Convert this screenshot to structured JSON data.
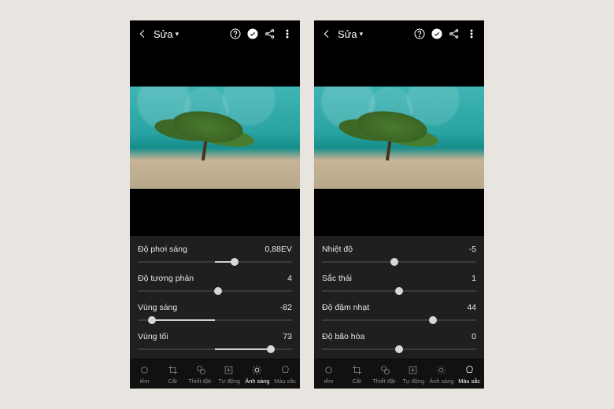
{
  "screens": [
    {
      "title": "Sửa",
      "sliders": [
        {
          "label": "Độ phơi sáng",
          "value": "0,88EV",
          "knob_pct": 63,
          "fill_from_pct": 50,
          "fill_to_pct": 63,
          "gradient": null
        },
        {
          "label": "Độ tương phản",
          "value": "4",
          "knob_pct": 52,
          "fill_from_pct": 50,
          "fill_to_pct": 52,
          "gradient": null
        },
        {
          "label": "Vùng sáng",
          "value": "-82",
          "knob_pct": 9,
          "fill_from_pct": 9,
          "fill_to_pct": 50,
          "gradient": null
        },
        {
          "label": "Vùng tối",
          "value": "73",
          "knob_pct": 86,
          "fill_from_pct": 50,
          "fill_to_pct": 86,
          "gradient": null
        }
      ],
      "tabs": [
        {
          "label": "iểm",
          "icon": "aim"
        },
        {
          "label": "Cắt",
          "icon": "crop"
        },
        {
          "label": "Thiết đặt sẵn",
          "icon": "preset"
        },
        {
          "label": "Tự động",
          "icon": "auto"
        },
        {
          "label": "Ánh sáng",
          "icon": "light",
          "active": true
        },
        {
          "label": "Màu sắc",
          "icon": "color"
        }
      ]
    },
    {
      "title": "Sửa",
      "sliders": [
        {
          "label": "Nhiệt độ",
          "value": "-5",
          "knob_pct": 47,
          "fill_from_pct": 47,
          "fill_to_pct": 50,
          "gradient": "grad-temp"
        },
        {
          "label": "Sắc thái",
          "value": "1",
          "knob_pct": 50,
          "fill_from_pct": 50,
          "fill_to_pct": 50,
          "gradient": "grad-tint"
        },
        {
          "label": "Độ đậm nhạt",
          "value": "44",
          "knob_pct": 72,
          "fill_from_pct": 50,
          "fill_to_pct": 72,
          "gradient": "grad-vib"
        },
        {
          "label": "Độ bão hòa",
          "value": "0",
          "knob_pct": 50,
          "fill_from_pct": 50,
          "fill_to_pct": 50,
          "gradient": "grad-sat"
        }
      ],
      "tabs": [
        {
          "label": "iểm",
          "icon": "aim"
        },
        {
          "label": "Cắt",
          "icon": "crop"
        },
        {
          "label": "Thiết đặt sẵn",
          "icon": "preset"
        },
        {
          "label": "Tự động",
          "icon": "auto"
        },
        {
          "label": "Ánh sáng",
          "icon": "light"
        },
        {
          "label": "Màu sắc",
          "icon": "color",
          "active": true
        }
      ]
    }
  ]
}
